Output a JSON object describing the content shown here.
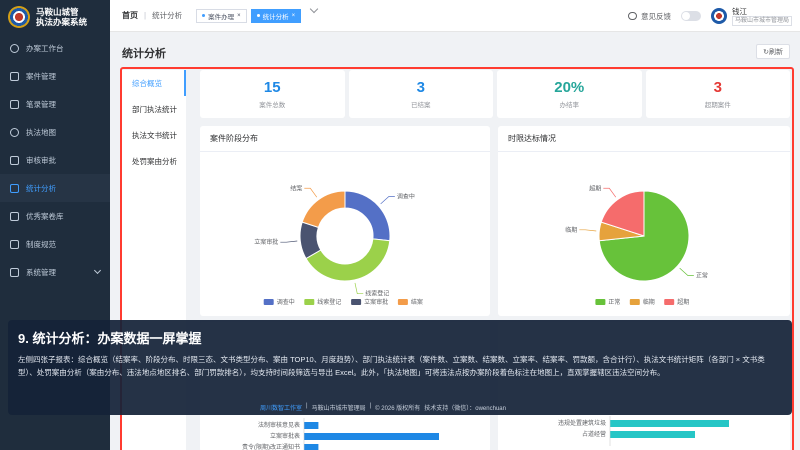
{
  "app": {
    "title_line1": "马鞍山城管",
    "title_line2": "执法办案系统"
  },
  "sidebar": {
    "items": [
      {
        "label": "办案工作台",
        "icon": "dashboard-icon",
        "active": false
      },
      {
        "label": "案件管理",
        "icon": "folder-icon",
        "active": false
      },
      {
        "label": "笔录管理",
        "icon": "document-icon",
        "active": false
      },
      {
        "label": "执法地图",
        "icon": "map-pin-icon",
        "active": false
      },
      {
        "label": "审核审批",
        "icon": "stamp-icon",
        "active": false
      },
      {
        "label": "统计分析",
        "icon": "chart-icon",
        "active": true
      },
      {
        "label": "优秀案卷库",
        "icon": "star-icon",
        "active": false
      },
      {
        "label": "制度规范",
        "icon": "book-icon",
        "active": false
      },
      {
        "label": "系统管理",
        "icon": "gear-icon",
        "active": false
      }
    ]
  },
  "header": {
    "breadcrumb_home": "首页",
    "breadcrumb_current": "统计分析",
    "tabs": [
      {
        "label": "案件办理",
        "close": "×"
      },
      {
        "label": "统计分析",
        "close": "×"
      }
    ],
    "feedback": "意见反馈",
    "user_name": "钱江",
    "user_org": "马鞍山市城市管理局"
  },
  "page": {
    "title": "统计分析",
    "refresh": "↻刷新"
  },
  "subnav": [
    "综合概览",
    "部门执法统计",
    "执法文书统计",
    "处罚案由分析"
  ],
  "kpis": [
    {
      "value": "15",
      "label": "案件总数",
      "color": "#1e88e5"
    },
    {
      "value": "3",
      "label": "已结案",
      "color": "#1e88e5"
    },
    {
      "value": "20%",
      "label": "办结率",
      "color": "#26a69a"
    },
    {
      "value": "3",
      "label": "超期案件",
      "color": "#e53935"
    }
  ],
  "chart_stage": {
    "title": "案件阶段分布",
    "chart_data": {
      "type": "pie",
      "labels": [
        "调查中",
        "线索登记",
        "立案审批",
        "结案"
      ],
      "values": [
        4,
        6,
        2,
        3
      ],
      "colors": [
        "#5470c6",
        "#9bd14a",
        "#4a5370",
        "#f39c4a"
      ]
    }
  },
  "chart_deadline": {
    "title": "时限达标情况",
    "chart_data": {
      "type": "pie",
      "labels": [
        "正常",
        "临期",
        "超期"
      ],
      "values": [
        11,
        1,
        3
      ],
      "colors": [
        "#67c23a",
        "#e6a23c",
        "#f56c6c"
      ]
    }
  },
  "row2": {
    "left_labels": [
      "法制审核意见表",
      "立案审批表",
      "责令(限期)改正通知书"
    ],
    "left_values": [
      0.08,
      0.75,
      0.08
    ],
    "right_labels": [
      "违规处置建筑垃圾",
      "占道经营"
    ],
    "right_values": [
      0.7,
      0.5
    ]
  },
  "overlay": {
    "title": "9. 统计分析：办案数据一屏掌握",
    "body": "左侧四张子报表：综合概览（结案率、阶段分布、时限三态、文书类型分布、案由 TOP10、月度趋势）、部门执法统计表（案件数、立案数、结案数、立案率、结案率、罚款额，含合计行）、执法文书统计矩阵（各部门 × 文书类型）、处罚案由分析（案由分布、违法地点地区排名、部门罚款排名），均支持时间段筛选与导出 Excel。此外，「执法地图」可将违法点按办案阶段着色标注在地图上，直观掌握辖区违法空间分布。"
  },
  "footer": {
    "studio": "周川数智工作室",
    "org": "马鞍山市城市管理局",
    "copyright": "© 2026 版权所有",
    "support": "技术支持（微信）：owenchuan",
    "sep": "|"
  }
}
